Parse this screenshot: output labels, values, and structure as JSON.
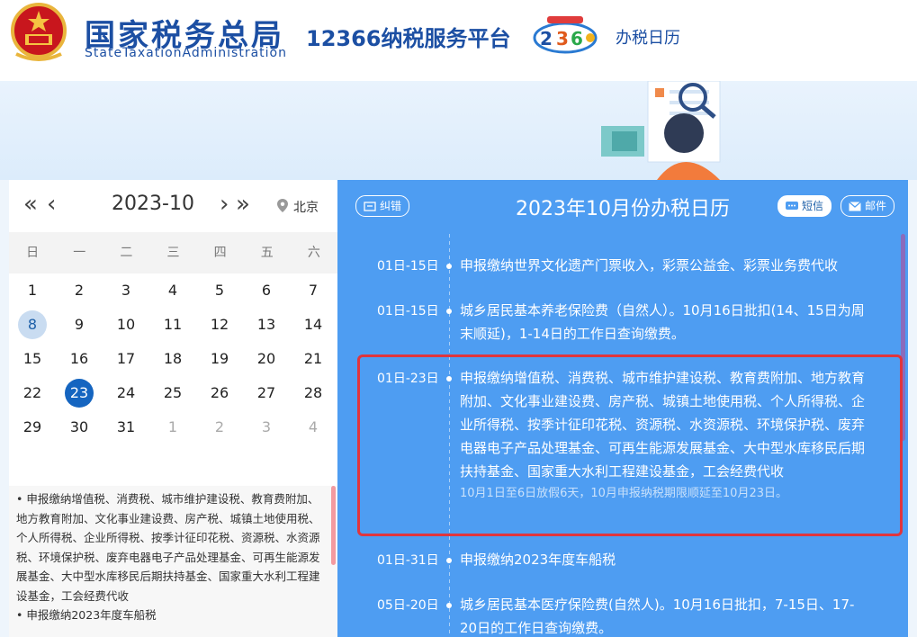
{
  "header": {
    "org_cn": "国家税务总局",
    "org_en": "StateTaxationAdministration",
    "platform": "12366纳税服务平台",
    "page_title": "办税日历"
  },
  "calendar": {
    "prev_year": "«",
    "prev_month": "‹",
    "month": "2023-10",
    "next_month": "›",
    "next_year": "»",
    "city": "北京",
    "weekdays": [
      "日",
      "一",
      "二",
      "三",
      "四",
      "五",
      "六"
    ],
    "days": [
      {
        "d": "1",
        "type": "cur"
      },
      {
        "d": "2",
        "type": "cur"
      },
      {
        "d": "3",
        "type": "cur"
      },
      {
        "d": "4",
        "type": "cur"
      },
      {
        "d": "5",
        "type": "cur"
      },
      {
        "d": "6",
        "type": "cur"
      },
      {
        "d": "7",
        "type": "cur"
      },
      {
        "d": "8",
        "type": "hl"
      },
      {
        "d": "9",
        "type": "cur"
      },
      {
        "d": "10",
        "type": "cur"
      },
      {
        "d": "11",
        "type": "cur"
      },
      {
        "d": "12",
        "type": "cur"
      },
      {
        "d": "13",
        "type": "cur"
      },
      {
        "d": "14",
        "type": "cur"
      },
      {
        "d": "15",
        "type": "cur"
      },
      {
        "d": "16",
        "type": "cur"
      },
      {
        "d": "17",
        "type": "cur"
      },
      {
        "d": "18",
        "type": "cur"
      },
      {
        "d": "19",
        "type": "cur"
      },
      {
        "d": "20",
        "type": "cur"
      },
      {
        "d": "21",
        "type": "cur"
      },
      {
        "d": "22",
        "type": "cur"
      },
      {
        "d": "23",
        "type": "today"
      },
      {
        "d": "24",
        "type": "cur"
      },
      {
        "d": "25",
        "type": "cur"
      },
      {
        "d": "26",
        "type": "cur"
      },
      {
        "d": "27",
        "type": "cur"
      },
      {
        "d": "28",
        "type": "cur"
      },
      {
        "d": "29",
        "type": "cur"
      },
      {
        "d": "30",
        "type": "cur"
      },
      {
        "d": "31",
        "type": "cur"
      },
      {
        "d": "1",
        "type": "other"
      },
      {
        "d": "2",
        "type": "other"
      },
      {
        "d": "3",
        "type": "other"
      },
      {
        "d": "4",
        "type": "other"
      }
    ],
    "note_text": "• 申报缴纳增值税、消费税、城市维护建设税、教育费附加、地方教育附加、文化事业建设费、房产税、城镇土地使用税、个人所得税、企业所得税、按季计征印花税、资源税、水资源税、环境保护税、废弃电器电子产品处理基金、可再生能源发展基金、大中型水库移民后期扶持基金、国家重大水利工程建设基金，工会经费代收",
    "note_next": "• 申报缴纳2023年度车船税"
  },
  "panel": {
    "title": "2023年10月份办税日历",
    "correct_btn": "纠错",
    "sms_btn": "短信",
    "mail_btn": "邮件",
    "items": [
      {
        "date": "01日-15日",
        "text": "申报缴纳世界文化遗产门票收入，彩票公益金、彩票业务费代收",
        "sub": ""
      },
      {
        "date": "01日-15日",
        "text": "城乡居民基本养老保险费（自然人）。10月16日批扣(14、15日为周末顺延)，1-14日的工作日查询缴费。",
        "sub": ""
      },
      {
        "date": "01日-23日",
        "text": "申报缴纳增值税、消费税、城市维护建设税、教育费附加、地方教育附加、文化事业建设费、房产税、城镇土地使用税、个人所得税、企业所得税、按季计征印花税、资源税、水资源税、环境保护税、废弃电器电子产品处理基金、可再生能源发展基金、大中型水库移民后期扶持基金、国家重大水利工程建设基金，工会经费代收",
        "sub": "10月1日至6日放假6天，10月申报纳税期限顺延至10月23日。"
      },
      {
        "date": "01日-31日",
        "text": "申报缴纳2023年度车船税",
        "sub": ""
      },
      {
        "date": "05日-20日",
        "text": "城乡居民基本医疗保险费(自然人)。10月16日批扣，7-15日、17-20日的工作日查询缴费。",
        "sub": ""
      }
    ]
  },
  "colors": {
    "brand": "#1c4fa3",
    "panel_blue": "#4e9df2",
    "today": "#1565c0",
    "highlight_border": "#e0353d"
  }
}
